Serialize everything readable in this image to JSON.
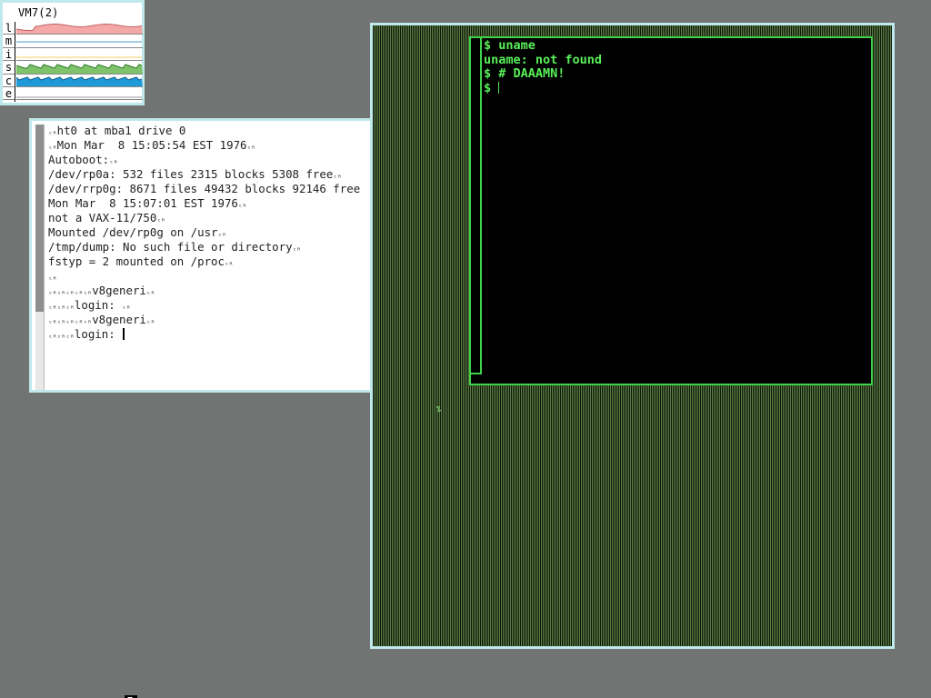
{
  "vm_monitor": {
    "title": "VM7(2)",
    "rows": [
      {
        "letter": "l",
        "color": "#f4a8a8",
        "line": "#c06060"
      },
      {
        "letter": "m",
        "color": "#ffffff",
        "line": "#4a9ac8"
      },
      {
        "letter": "i",
        "color": "#ffffff",
        "line": "#f0d060"
      },
      {
        "letter": "s",
        "color": "#7ec26a",
        "line": "#2f7a2a"
      },
      {
        "letter": "c",
        "color": "#1f9ad8",
        "line": "#106090"
      },
      {
        "letter": "e",
        "color": "#ffffff",
        "line": "#999999"
      }
    ]
  },
  "console": {
    "lines": [
      {
        "pre": "",
        "cr_before": true,
        "text": "ht0 at mba1 drive 0",
        "cr_after": false
      },
      {
        "pre": "",
        "cr_before": true,
        "text": "Mon Mar  8 15:05:54 EST 1976",
        "cr_after": true
      },
      {
        "pre": "",
        "cr_before": false,
        "text": "Autoboot:",
        "cr_after": true
      },
      {
        "pre": "",
        "cr_before": false,
        "text": "/dev/rp0a: 532 files 2315 blocks 5308 free",
        "cr_after": true
      },
      {
        "pre": "",
        "cr_before": false,
        "text": "/dev/rrp0g: 8671 files 49432 blocks 92146 free",
        "cr_after": false
      },
      {
        "pre": "",
        "cr_before": false,
        "text": "Mon Mar  8 15:07:01 EST 1976",
        "cr_after": true
      },
      {
        "pre": "",
        "cr_before": false,
        "text": "not a VAX-11/750",
        "cr_after": true
      },
      {
        "pre": "",
        "cr_before": false,
        "text": "Mounted /dev/rp0g on /usr",
        "cr_after": true
      },
      {
        "pre": "",
        "cr_before": false,
        "text": "/tmp/dump: No such file or directory",
        "cr_after": true
      },
      {
        "pre": "",
        "cr_before": false,
        "text": "fstyp = 2 mounted on /proc",
        "cr_after": true
      },
      {
        "pre": "",
        "cr_before": true,
        "text": "",
        "cr_after": false
      },
      {
        "pre": "",
        "cr_before": false,
        "text": "v8generi",
        "cr_after": true,
        "cr_count": 5
      },
      {
        "pre": "",
        "cr_before": false,
        "text": "login: ",
        "cr_after": true,
        "cr_count": 3
      },
      {
        "pre": "",
        "cr_before": false,
        "text": "v8generi",
        "cr_after": true,
        "cr_count": 5
      },
      {
        "pre": "",
        "cr_before": false,
        "text": "login: ",
        "cr_after": false,
        "cr_count": 3,
        "cursor": true
      }
    ]
  },
  "terminal": {
    "lines": [
      "$ uname",
      "uname: not found",
      "$ # DAAAMN!",
      "$ "
    ]
  },
  "colors": {
    "desktop": "#717472",
    "frame": "#bfe9ea",
    "terminal_text": "#5af05a",
    "terminal_border": "#3ed24a"
  }
}
